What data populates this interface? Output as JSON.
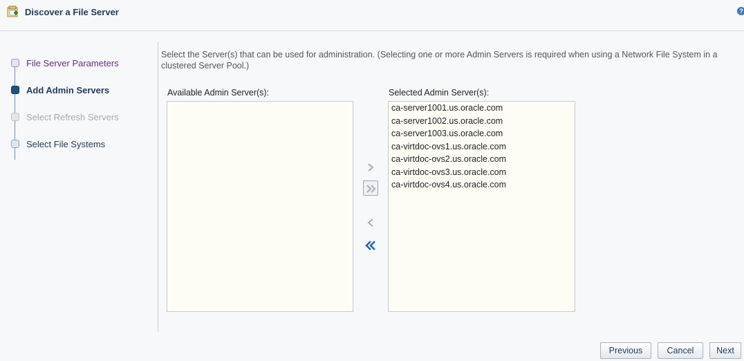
{
  "dialog": {
    "title": "Discover a File Server",
    "help_icon": "help-icon"
  },
  "train": {
    "steps": [
      {
        "label": "File Server Parameters",
        "state": "visited"
      },
      {
        "label": "Add Admin Servers",
        "state": "current"
      },
      {
        "label": "Select Refresh Servers",
        "state": "disabled"
      },
      {
        "label": "Select File Systems",
        "state": "next"
      }
    ]
  },
  "instructions": "Select the Server(s) that can be used for administration. (Selecting one or more Admin Servers is required when using a Network File System in a clustered Server Pool.)",
  "shuttle": {
    "available_label": "Available Admin Server(s):",
    "selected_label": "Selected Admin Server(s):",
    "available_items": [],
    "selected_items": [
      "ca-server1001.us.oracle.com",
      "ca-server1002.us.oracle.com",
      "ca-server1003.us.oracle.com",
      "ca-virtdoc-ovs1.us.oracle.com",
      "ca-virtdoc-ovs2.us.oracle.com",
      "ca-virtdoc-ovs3.us.oracle.com",
      "ca-virtdoc-ovs4.us.oracle.com"
    ],
    "icons": [
      "move-right-icon",
      "move-all-right-icon",
      "move-left-icon",
      "move-all-left-icon"
    ]
  },
  "footer": {
    "previous_label": "Previous",
    "cancel_label": "Cancel",
    "next_label": "Next"
  },
  "colors": {
    "title": "#1e3b5a",
    "current_step": "#1d5289",
    "visited_step": "#6c2b82",
    "active_shuttle_arrow": "#2266b0",
    "disabled_shuttle_arrow": "#a9adb2"
  }
}
